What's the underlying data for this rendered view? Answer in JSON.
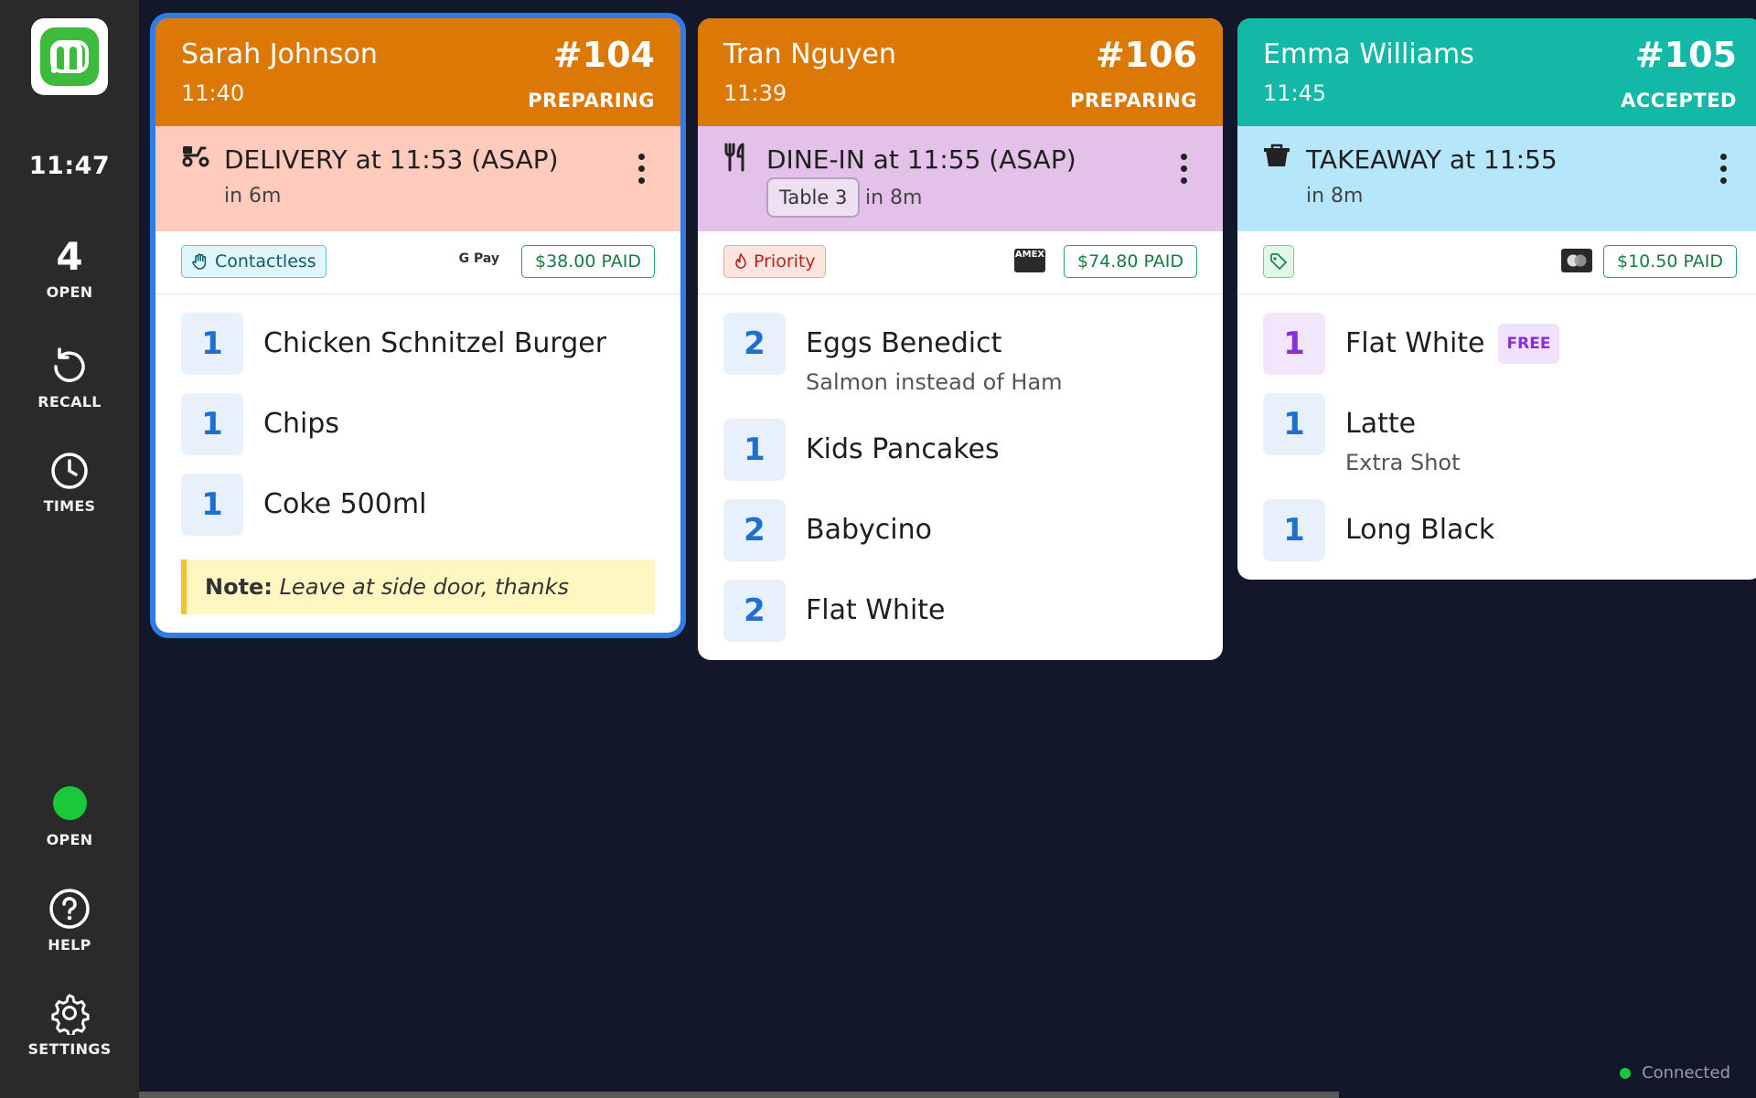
{
  "sidebar": {
    "clock": "11:47",
    "open_count": "4",
    "open_label": "OPEN",
    "recall_label": "RECALL",
    "times_label": "TIMES",
    "status_label": "OPEN",
    "help_label": "HELP",
    "settings_label": "SETTINGS",
    "status_color": "#19c93a"
  },
  "orders": [
    {
      "customer": "Sarah Johnson",
      "time": "11:40",
      "number": "#104",
      "status": "PREPARING",
      "header_color": "#dc7806",
      "band_color": "#ffcbbd",
      "type_icon": "scooter-icon",
      "type_title": "DELIVERY at 11:53 (ASAP)",
      "eta": "in 6m",
      "tag": "Contactless",
      "tag_icon": "hand-icon",
      "payment_brand": "G Pay",
      "paid": "$38.00 PAID",
      "items": [
        {
          "qty": "1",
          "name": "Chicken Schnitzel Burger"
        },
        {
          "qty": "1",
          "name": "Chips"
        },
        {
          "qty": "1",
          "name": "Coke 500ml"
        }
      ],
      "note_label": "Note:",
      "note_text": "Leave at side door, thanks"
    },
    {
      "customer": "Tran Nguyen",
      "time": "11:39",
      "number": "#106",
      "status": "PREPARING",
      "header_color": "#dc7806",
      "band_color": "#e3c1e9",
      "type_icon": "cutlery-icon",
      "type_title": "DINE-IN at 11:55 (ASAP)",
      "table": "Table 3",
      "eta": "in 8m",
      "tag": "Priority",
      "tag_icon": "flame-icon",
      "payment_brand": "AMEX",
      "paid": "$74.80 PAID",
      "items": [
        {
          "qty": "2",
          "name": "Eggs Benedict",
          "modifier": "Salmon instead of Ham"
        },
        {
          "qty": "1",
          "name": "Kids Pancakes"
        },
        {
          "qty": "2",
          "name": "Babycino"
        },
        {
          "qty": "2",
          "name": "Flat White"
        }
      ]
    },
    {
      "customer": "Emma Williams",
      "time": "11:45",
      "number": "#105",
      "status": "ACCEPTED",
      "header_color": "#14b8a6",
      "band_color": "#b5e6fa",
      "type_icon": "takeaway-bag-icon",
      "type_title": "TAKEAWAY at 11:55",
      "eta": "in 8m",
      "tag_icon": "price-tag-icon",
      "payment_brand": "mastercard",
      "paid": "$10.50 PAID",
      "items": [
        {
          "qty": "1",
          "name": "Flat White",
          "badge": "FREE"
        },
        {
          "qty": "1",
          "name": "Latte",
          "modifier": "Extra Shot"
        },
        {
          "qty": "1",
          "name": "Long Black"
        }
      ]
    }
  ],
  "footer": {
    "connection": "Connected"
  }
}
